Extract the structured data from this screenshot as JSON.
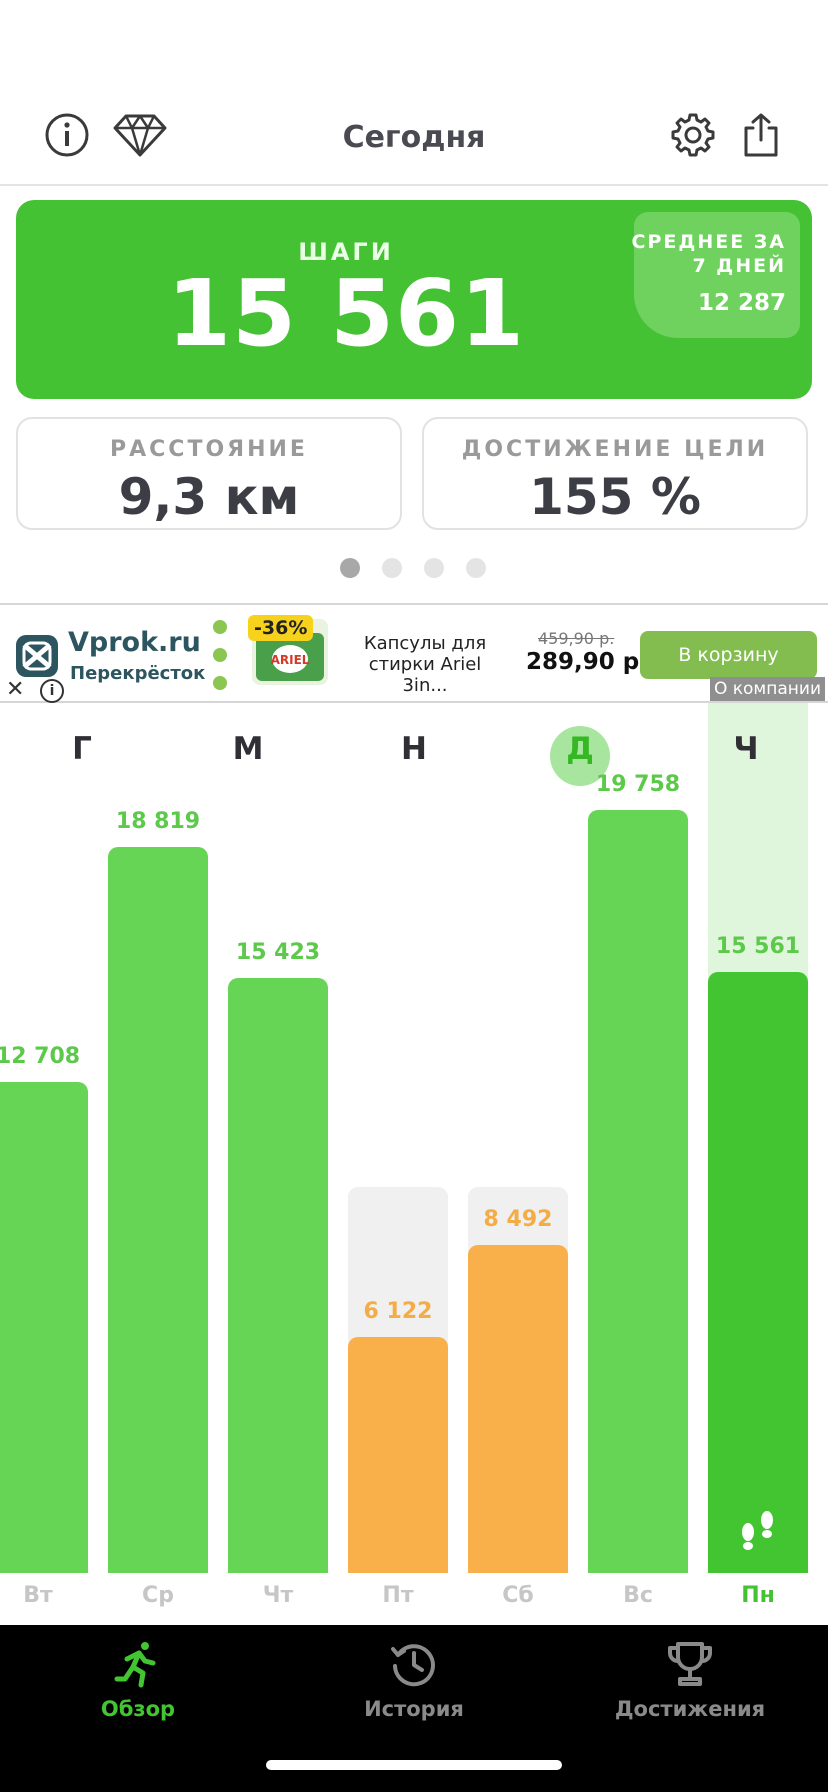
{
  "header": {
    "title": "Сегодня",
    "icons": [
      "info-icon",
      "diamond-icon",
      "gear-icon",
      "share-icon"
    ]
  },
  "steps": {
    "label": "ШАГИ",
    "value": "15 561",
    "avg_label": "СРЕДНЕЕ ЗА 7 ДНЕЙ",
    "avg_value": "12 287"
  },
  "stats": {
    "distance_label": "РАССТОЯНИЕ",
    "distance_value": "9,3 км",
    "goal_label": "ДОСТИЖЕНИЕ ЦЕЛИ",
    "goal_value": "155 %"
  },
  "pager": {
    "count": 4,
    "active": 0
  },
  "ad": {
    "brand": "Vprok.ru",
    "brand_sub": "Перекрёсток",
    "badge": "-36%",
    "description": "Капсулы для стирки Ariel 3in...",
    "old_price": "459,90 р.",
    "price": "289,90 р.",
    "cart_button": "В корзину",
    "about": "О компании"
  },
  "month_letters": [
    "Г",
    "М",
    "Н",
    "Д",
    "Ч"
  ],
  "colors": {
    "brand_green": "#45c233",
    "bar_green": "#66d455",
    "today_green": "#43c532",
    "below_goal_orange": "#f9b04a",
    "label_green": "#5cc94b",
    "label_orange": "#f4ac45"
  },
  "chart_data": {
    "type": "bar",
    "categories": [
      "Вт",
      "Ср",
      "Чт",
      "Пт",
      "Сб",
      "Вс",
      "Пн"
    ],
    "values": [
      12708,
      18819,
      15423,
      6122,
      8492,
      19758,
      15561
    ],
    "value_labels": [
      "12 708",
      "18 819",
      "15 423",
      "6 122",
      "8 492",
      "19 758",
      "15 561"
    ],
    "goal": 10000,
    "today_index": 6,
    "title": "",
    "xlabel": "",
    "ylabel": ""
  },
  "tabs": [
    {
      "label": "Обзор",
      "icon": "running-person-icon",
      "active": true
    },
    {
      "label": "История",
      "icon": "history-icon",
      "active": false
    },
    {
      "label": "Достижения",
      "icon": "trophy-icon",
      "active": false
    }
  ]
}
